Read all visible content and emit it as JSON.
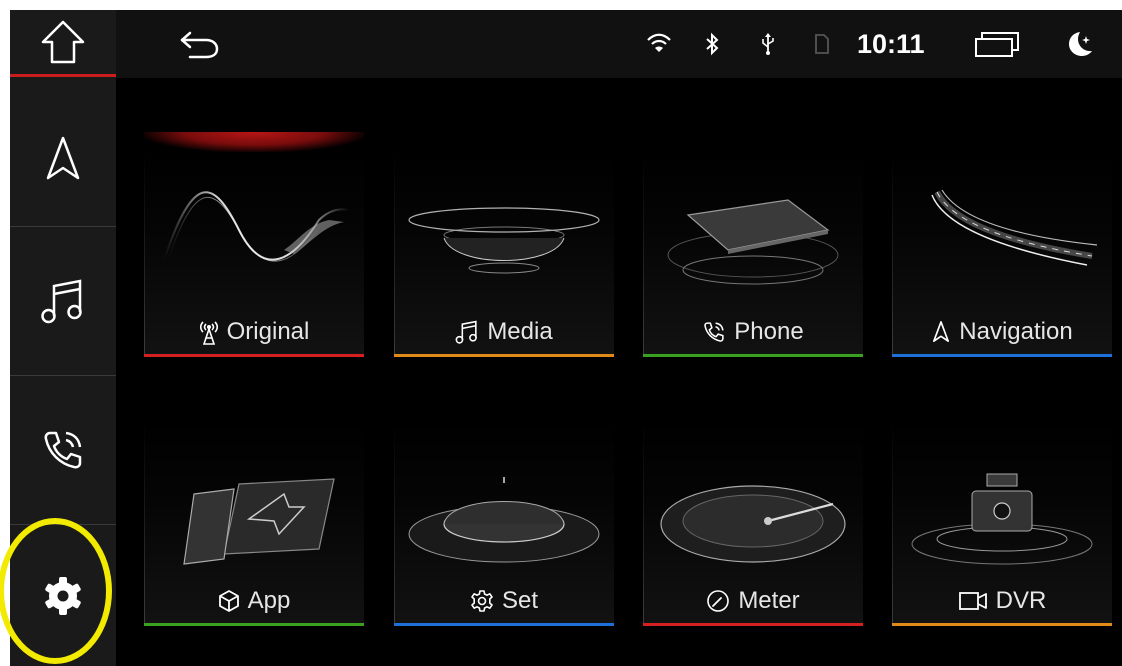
{
  "status_bar": {
    "time": "10:11",
    "icons": [
      "back-arrow-icon",
      "wifi-icon",
      "bluetooth-icon",
      "usb-icon",
      "sd-card-icon",
      "recent-apps-icon",
      "night-mode-icon"
    ]
  },
  "sidebar": {
    "items": [
      "home",
      "navigation",
      "music",
      "phone",
      "settings"
    ],
    "active": "settings"
  },
  "tiles": [
    {
      "label": "Original",
      "icon": "antenna-icon",
      "accent": "#d42020"
    },
    {
      "label": "Media",
      "icon": "music-note-icon",
      "accent": "#e08a1a"
    },
    {
      "label": "Phone",
      "icon": "phone-icon",
      "accent": "#3aa020"
    },
    {
      "label": "Navigation",
      "icon": "navigation-arrow-icon",
      "accent": "#1f6fd8"
    },
    {
      "label": "App",
      "icon": "cube-icon",
      "accent": "#3aa020"
    },
    {
      "label": "Set",
      "icon": "gear-icon",
      "accent": "#1f6fd8"
    },
    {
      "label": "Meter",
      "icon": "gauge-icon",
      "accent": "#d42020"
    },
    {
      "label": "DVR",
      "icon": "video-camera-icon",
      "accent": "#e08a1a"
    }
  ],
  "colors": {
    "background": "#000000",
    "sidebar": "#1a1a1a",
    "highlight": "#f2ea00"
  }
}
